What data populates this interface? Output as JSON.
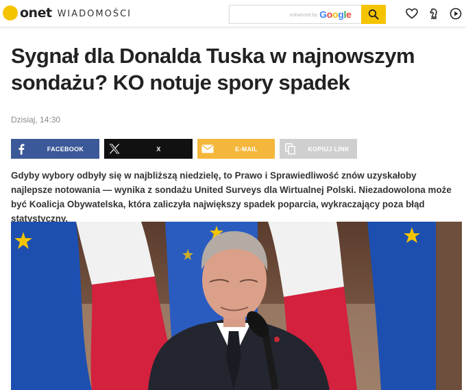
{
  "header": {
    "logo_text": "onet",
    "section": "WIADOMOŚCI",
    "search": {
      "enhanced_by": "enhanced by",
      "provider": "Google",
      "placeholder": ""
    },
    "icons": [
      "search-icon",
      "heart-icon",
      "chess-knight-icon",
      "play-icon"
    ]
  },
  "article": {
    "title": "Sygnał dla Donalda Tuska w najnowszym sondażu? KO notuje spory spadek",
    "timestamp": "Dzisiaj, 14:30",
    "share": {
      "facebook": "FACEBOOK",
      "x": "X",
      "email": "E-MAIL",
      "copy": "KOPIUJ LINK"
    },
    "lead": "Gdyby wybory odbyły się w najbliższą niedzielę, to Prawo i Sprawiedliwość znów uzyskałoby najlepsze notowania — wynika z sondażu United Surveys dla Wirtualnej Polski. Niezadowolona może być Koalicja Obywatelska, która zaliczyła największy spadek poparcia, wykraczający poza błąd statystyczny."
  },
  "colors": {
    "brand_yellow": "#f5c400",
    "facebook": "#3b5998",
    "x": "#111111",
    "email": "#f4b73b",
    "copy": "#cfcfcf",
    "eu_blue": "#1d4fb0",
    "flag_red": "#d4213d"
  }
}
